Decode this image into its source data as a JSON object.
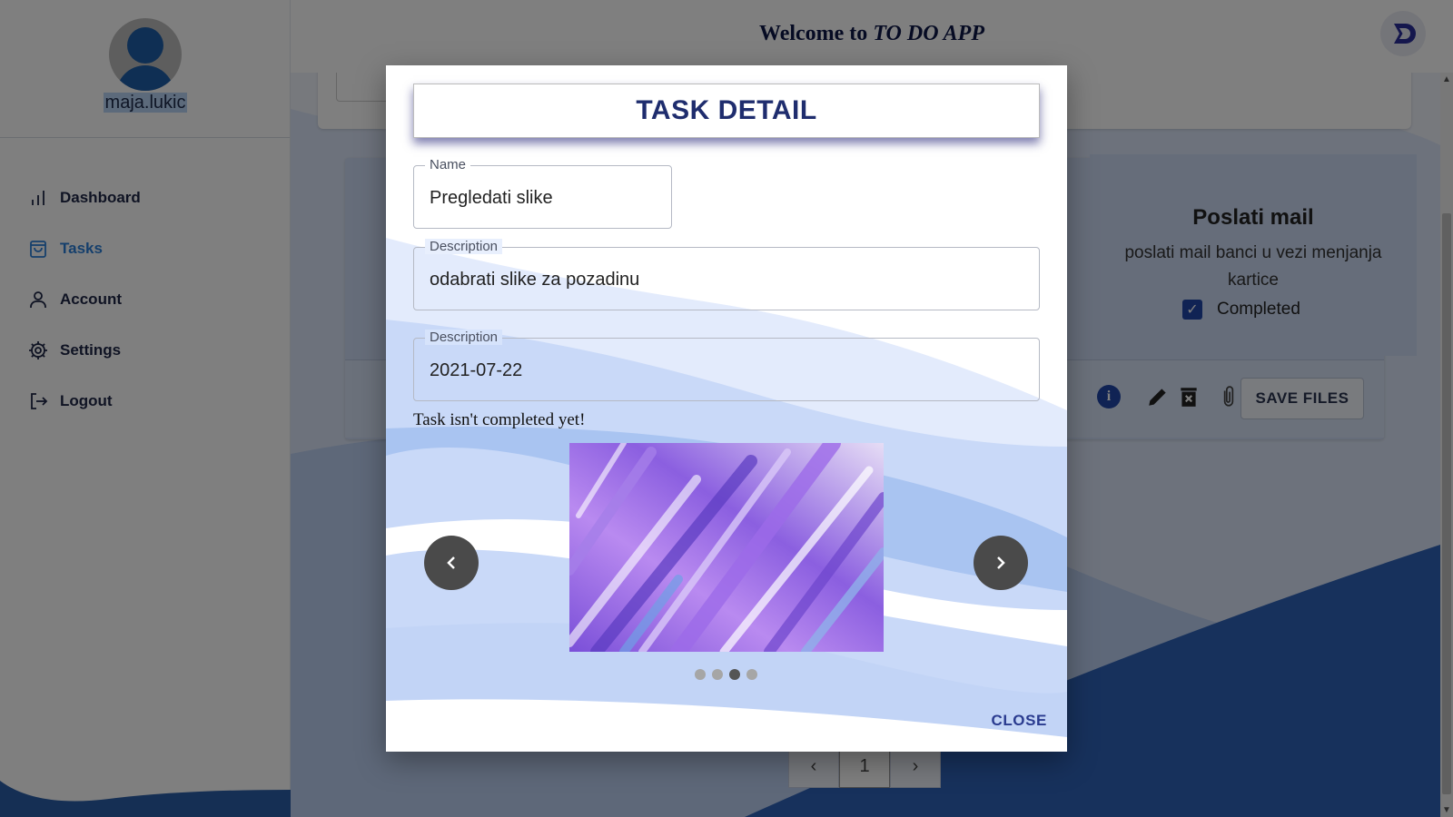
{
  "sidebar": {
    "username": "maja.lukic",
    "items": [
      {
        "label": "Dashboard",
        "icon": "bar-chart-icon"
      },
      {
        "label": "Tasks",
        "icon": "shopping-bag-icon",
        "active": true
      },
      {
        "label": "Account",
        "icon": "user-icon"
      },
      {
        "label": "Settings",
        "icon": "gear-icon"
      },
      {
        "label": "Logout",
        "icon": "logout-icon"
      }
    ]
  },
  "header": {
    "welcome_prefix": "Welcome to ",
    "app_name": "TO DO APP",
    "logo_icon": "app-logo-icon"
  },
  "background_task": {
    "title": "Poslati mail",
    "description": "poslati mail banci u vezi menjanja kartice",
    "completed_label": "Completed",
    "completed": true,
    "save_files_label": "SAVE FILES"
  },
  "pagination": {
    "current_page": "1"
  },
  "modal": {
    "title": "TASK DETAIL",
    "name_label": "Name",
    "name_value": "Pregledati slike",
    "description_label": "Description",
    "description_value": "odabrati slike za pozadinu",
    "date_label": "Description",
    "date_value": "2021-07-22",
    "status_text": "Task isn't completed yet!",
    "carousel": {
      "total_slides": 4,
      "active_slide_index": 2
    },
    "close_label": "CLOSE"
  },
  "colors": {
    "accent": "#2046a8",
    "active_nav": "#2b7fd8",
    "title_blue": "#1f2d6e"
  }
}
